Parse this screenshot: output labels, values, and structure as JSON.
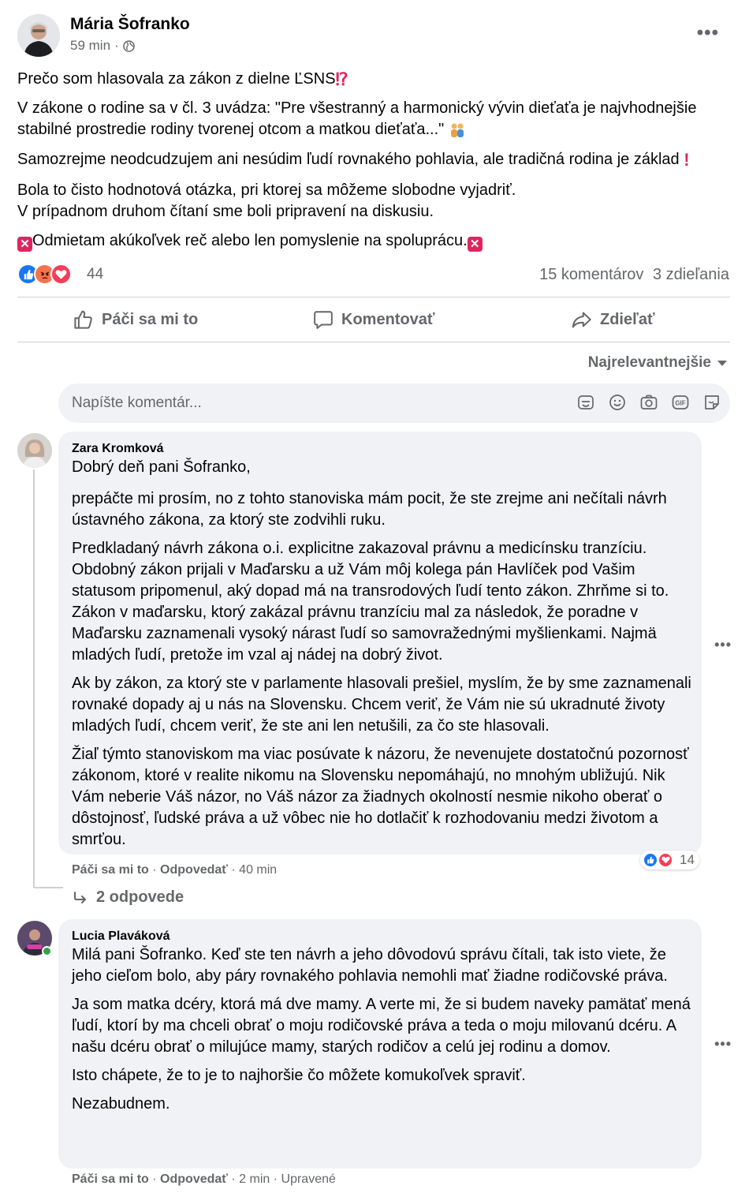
{
  "post": {
    "author": "Mária Šofranko",
    "time": "59 min",
    "separator": "·",
    "paragraphs": {
      "p1": "Prečo som hlasovala za zákon z dielne ĽSNS",
      "p2": "V zákone o rodine sa v čl. 3 uvádza: \"Pre všestranný a harmonický vývin dieťaťa je najvhodnejšie stabilné prostredie rodiny tvorenej otcom a matkou dieťaťa...\"",
      "p3": "Samozrejme neodcudzujem ani nesúdim ľudí rovnakého pohlavia, ale tradičná rodina je základ",
      "p4a": "Bola to čisto hodnotová otázka, pri ktorej sa môžeme slobodne vyjadriť.",
      "p4b": "V prípadnom druhom čítaní sme boli pripravení na diskusiu.",
      "p5": "Odmietam akúkoľvek reč alebo len pomyslenie na  spoluprácu."
    },
    "reaction_count": "44",
    "comments_count": "15 komentárov",
    "shares_count": "3 zdieľania"
  },
  "actions": {
    "like": "Páči sa mi to",
    "comment": "Komentovať",
    "share": "Zdieľať"
  },
  "sort_label": "Najrelevantnejšie",
  "comment_input": {
    "placeholder": "Napíšte komentár..."
  },
  "comments": [
    {
      "author": "Zara Kromková",
      "paragraphs": [
        "Dobrý deň pani Šofranko,",
        "prepáčte mi prosím, no z tohto stanoviska mám pocit, že ste zrejme ani nečítali návrh ústavného zákona, za ktorý ste zodvihli ruku.",
        "Predkladaný návrh zákona o.i. explicitne zakazoval právnu a medicínsku tranzíciu. Obdobný zákon prijali v Maďarsku a už Vám môj kolega pán Havlíček pod Vašim statusom pripomenul, aký dopad má na transrodových ľudí tento zákon. Zhrňme si to. Zákon v maďarsku, ktorý zakázal právnu tranzíciu mal za následok, že poradne v Maďarsku zaznamenali vysoký nárast ľudí so samovražednými myšlienkami. Najmä mladých ľudí, pretože im vzal aj nádej na dobrý život.",
        "Ak by zákon, za ktorý ste v parlamente hlasovali prešiel, myslím, že by sme zaznamenali rovnaké dopady aj u nás na Slovensku. Chcem veriť, že Vám nie sú ukradnuté životy mladých ľudí, chcem veriť, že ste ani len netušili, za čo ste hlasovali.",
        "Žiaľ týmto stanoviskom ma viac posúvate k názoru, že nevenujete dostatočnú pozornosť zákonom, ktoré v realite nikomu na Slovensku nepomáhajú, no mnohým ubližujú. Nik Vám neberie Váš názor, no Váš názor za žiadnych okolností nesmie nikoho oberať o dôstojnosť, ľudské práva a už vôbec nie ho dotlačiť k rozhodovaniu medzi životom a smrťou."
      ],
      "like": "Páči sa mi to",
      "reply": "Odpovedať",
      "time": "40 min",
      "reactions": "14",
      "replies_label": "2 odpovede"
    },
    {
      "author": "Lucia Plaváková",
      "paragraphs": [
        "Milá pani Šofranko. Keď ste ten návrh a jeho dôvodovú správu čítali, tak isto viete, že jeho cieľom bolo, aby páry rovnakého pohlavia nemohli mať žiadne rodičovské práva.",
        "Ja som matka dcéry, ktorá má dve mamy. A verte mi, že si budem naveky pamätať mená ľudí, ktorí by ma chceli obrať o moju rodičovské práva a teda o moju milovanú dcéru. A našu dcéru obrať o milujúce mamy, starých rodičov a celú jej rodinu a domov.",
        "Isto chápete, že to je to najhoršie čo môžete komukoľvek spraviť.",
        "Nezabudnem."
      ],
      "like": "Páči sa mi to",
      "reply": "Odpovedať",
      "time": "2 min",
      "edited": "Upravené"
    }
  ],
  "colors": {
    "text": "#050505",
    "secondary": "#65676b",
    "bubble": "#f0f2f5",
    "like_blue": "#1877f2",
    "love_red": "#f33e58",
    "angry_orange": "#f7714c",
    "online_green": "#31a24c"
  },
  "icons": [
    "globe-icon",
    "more-icon",
    "like-icon",
    "love-icon",
    "angry-icon",
    "thumbs-up-icon",
    "comment-icon",
    "share-icon",
    "caret-down-icon",
    "sticker-icon",
    "emoji-icon",
    "camera-icon",
    "gif-icon",
    "avatar-sticker-icon",
    "reply-arrow-icon",
    "online-indicator"
  ]
}
